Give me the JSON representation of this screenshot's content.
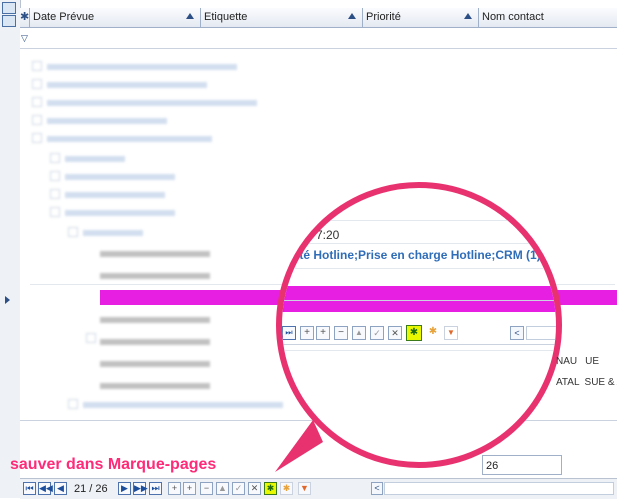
{
  "grid": {
    "columns": [
      {
        "label": "Date Prévue"
      },
      {
        "label": "Etiquette"
      },
      {
        "label": "Priorité"
      },
      {
        "label": "Nom contact"
      }
    ],
    "selected_row_value": "26"
  },
  "magnifier": {
    "time_text": "7:20",
    "tag_text": "ité Hotline;Prise en charge Hotline;CRM (1)",
    "right_text_1": "NAU",
    "right_text_1b": "UE",
    "right_text_2": "ATAL",
    "right_text_2b": "SUE & A"
  },
  "pager": {
    "page_indicator": "21 / 26"
  },
  "annotation": {
    "label": "sauver dans Marque-pages"
  },
  "colors": {
    "highlight_row": "#e61fe3",
    "callout": "#e8326f",
    "annotation_text": "#ff2a78",
    "save_bookmark_button": "#e8f800"
  }
}
